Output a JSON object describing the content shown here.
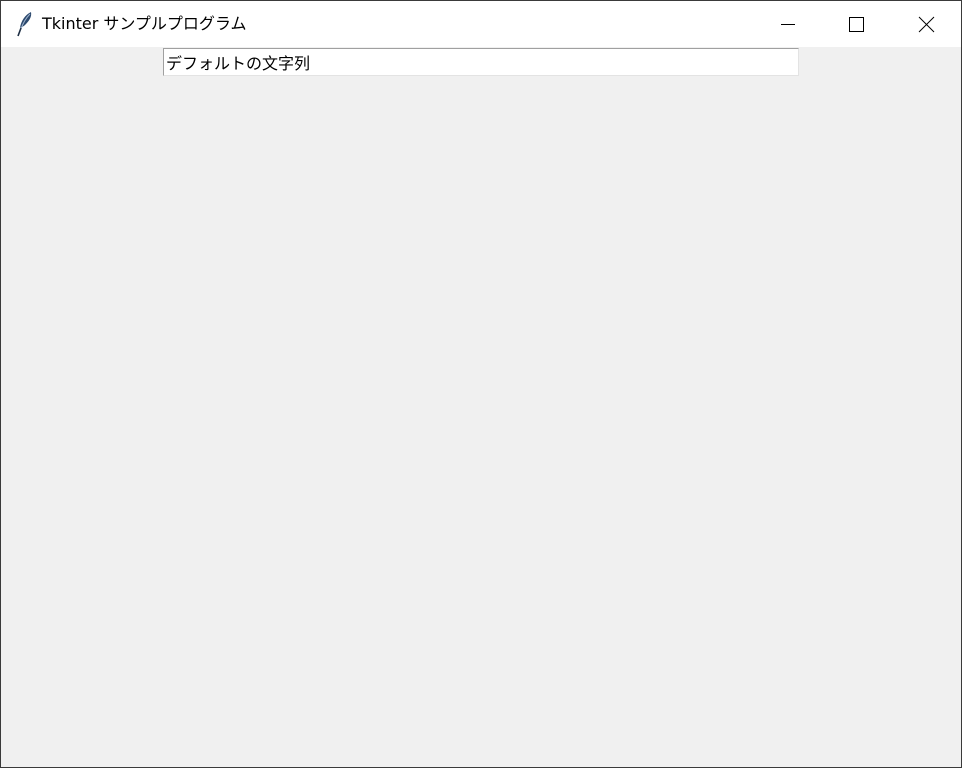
{
  "window": {
    "title": "Tkinter サンプルプログラム",
    "app_icon": "tk-feather-icon",
    "controls": {
      "minimize": "minimize-icon",
      "maximize": "maximize-icon",
      "close": "close-icon"
    }
  },
  "entry": {
    "value": "デフォルトの文字列"
  }
}
